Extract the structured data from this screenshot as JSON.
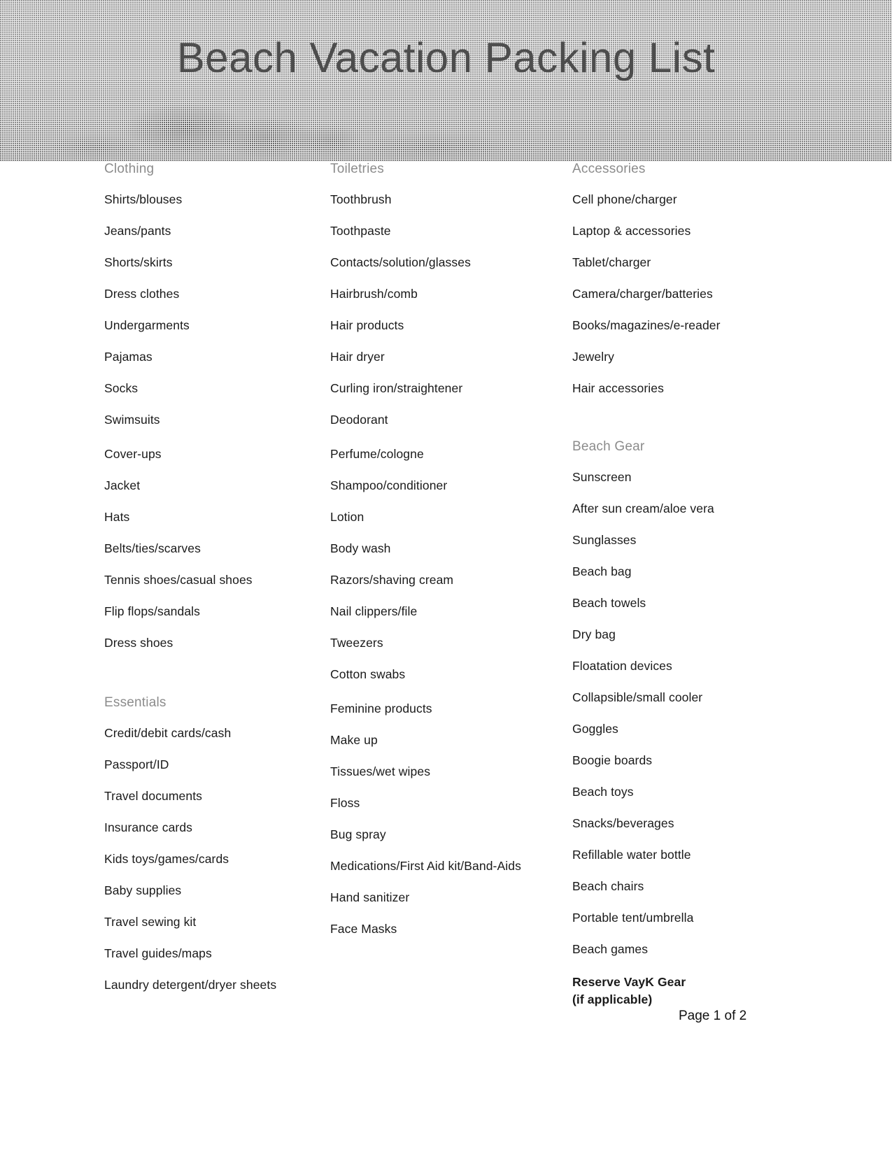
{
  "document": {
    "title": "Beach Vacation Packing List",
    "page_label": "Page 1 of 2"
  },
  "columns": [
    {
      "id": "column-left",
      "sections": [
        {
          "heading": "Clothing",
          "items": [
            "Shirts/blouses",
            "Jeans/pants",
            "Shorts/skirts",
            "Dress clothes",
            "Undergarments",
            "Pajamas",
            "Socks",
            "Swimsuits",
            "Cover-ups",
            "Jacket",
            "Hats",
            "Belts/ties/scarves",
            "Tennis shoes/casual shoes",
            "Flip flops/sandals",
            "Dress shoes"
          ]
        },
        {
          "heading": "Essentials",
          "items": [
            "Credit/debit cards/cash",
            "Passport/ID",
            "Travel documents",
            "Insurance cards",
            "Kids toys/games/cards",
            "Baby supplies",
            "Travel sewing kit",
            "Travel guides/maps",
            "Laundry detergent/dryer sheets"
          ]
        }
      ]
    },
    {
      "id": "column-middle",
      "sections": [
        {
          "heading": "Toiletries",
          "items": [
            "Toothbrush",
            "Toothpaste",
            "Contacts/solution/glasses",
            "Hairbrush/comb",
            "Hair products",
            "Hair dryer",
            "Curling iron/straightener",
            "Deodorant",
            "Perfume/cologne",
            "Shampoo/conditioner",
            "Lotion",
            "Body wash",
            "Razors/shaving cream",
            "Nail clippers/file",
            "Tweezers",
            "Cotton swabs",
            "Feminine products",
            "Make up",
            "Tissues/wet wipes",
            "Floss",
            "Bug spray",
            "Medications/First Aid kit/Band-Aids",
            "Hand sanitizer",
            "Face Masks"
          ]
        }
      ]
    },
    {
      "id": "column-right",
      "sections": [
        {
          "heading": "Accessories",
          "items": [
            "Cell phone/charger",
            "Laptop & accessories",
            "Tablet/charger",
            "Camera/charger/batteries",
            "Books/magazines/e-reader",
            "Jewelry",
            "Hair accessories"
          ]
        },
        {
          "heading": "Beach Gear",
          "items": [
            "Sunscreen",
            "After sun cream/aloe vera",
            "Sunglasses",
            "Beach bag",
            "Beach towels",
            "Dry bag",
            "Floatation devices",
            "Collapsible/small cooler",
            "Goggles",
            "Boogie boards",
            "Beach toys",
            "Snacks/beverages",
            "Refillable water bottle",
            "Beach chairs",
            "Portable tent/umbrella",
            "Beach games"
          ],
          "note_lines": [
            "Reserve VayK Gear",
            "(if applicable)"
          ]
        }
      ]
    }
  ],
  "colors": {
    "heading_gray": "#8c8c8c",
    "body_black": "#1a1a1a",
    "banner_bg": "#e9e9e9",
    "title_gray": "#4d4d4d"
  }
}
